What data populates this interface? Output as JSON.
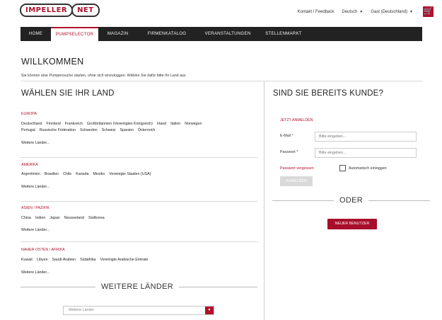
{
  "header": {
    "logo_left": "IMPELLER",
    "logo_right": "NET",
    "links": [
      "Kontakt / Feedback",
      "Deutsch",
      "Gast (Deutschland)"
    ],
    "cart_icon": "cart-icon"
  },
  "nav": {
    "items": [
      "HOME",
      "PUMPSELECTOR",
      "MAGAZIN",
      "FIRMENKATALOG",
      "VERANSTALTUNGEN",
      "STELLENMARKT"
    ],
    "active": "PUMPSELECTOR"
  },
  "page": {
    "title": "WILLKOMMEN",
    "intro": "Sie können eine Pumpensuche starten, ohne sich einzuloggen. Wählen Sie dafür bitte Ihr Land aus"
  },
  "countries": {
    "title": "WÄHLEN SIE IHR LAND",
    "regions": [
      {
        "name": "EUROPA",
        "countries": [
          "Deutschland",
          "Finnland",
          "Frankreich",
          "Großbritannien (Vereinigtes Königreich)",
          "Irland",
          "Italien",
          "Norwegen",
          "Portugal",
          "Russische Föderation",
          "Schweden",
          "Schweiz",
          "Spanien",
          "Österreich"
        ],
        "more": "Weitere Länder..."
      },
      {
        "name": "AMERIKA",
        "countries": [
          "Argentinien",
          "Brasilien",
          "Chile",
          "Kanada",
          "Mexiko",
          "Vereinigte Staaten (USA)"
        ],
        "more": "Weitere Länder..."
      },
      {
        "name": "ASIEN / PAZIFIK",
        "countries": [
          "China",
          "Indien",
          "Japan",
          "Neuseeland",
          "Südkorea"
        ],
        "more": "Weitere Länder..."
      },
      {
        "name": "NAHER OSTEN / AFRIKA",
        "countries": [
          "Kuwait",
          "Libyen",
          "Saudi-Arabien",
          "Südafrika",
          "Vereinigte Arabische Emirate"
        ],
        "more": "Weitere Länder..."
      }
    ],
    "more_title": "WEITERE LÄNDER",
    "select_placeholder": "Weitere Länder"
  },
  "login": {
    "title": "SIND SIE BEREITS KUNDE?",
    "subtitle": "JETZT ANMELDEN",
    "email_label": "E-Mail *",
    "email_placeholder": "Bitte eingeben...",
    "password_label": "Passwort *",
    "password_placeholder": "Bitte eingeben...",
    "forgot": "Passwort vergessen",
    "auto_login": "Automatisch einloggen",
    "submit": "ANMELDEN",
    "or": "ODER",
    "new_user": "NEUER BENUTZER"
  },
  "colors": {
    "accent": "#b0102b",
    "nav_bg": "#222222"
  }
}
